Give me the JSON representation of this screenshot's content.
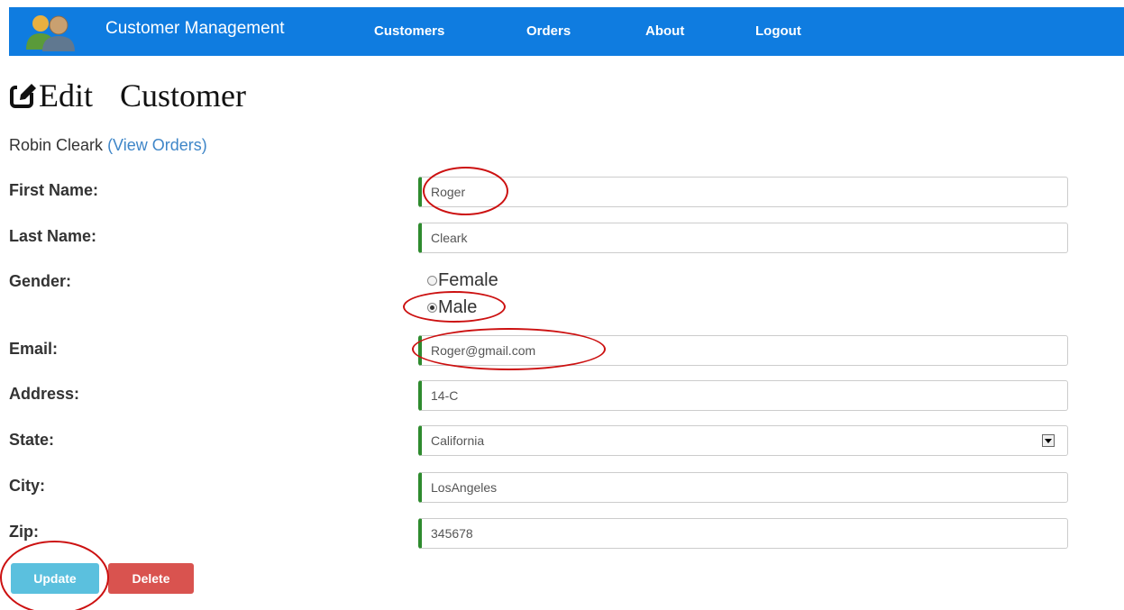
{
  "navbar": {
    "brand": "Customer Management",
    "links": [
      "Customers",
      "Orders",
      "About",
      "Logout"
    ],
    "logo_icon": "users-icon",
    "color": "#0f7ce0"
  },
  "heading": {
    "icon": "edit-icon",
    "word1": "Edit",
    "word2": "Customer"
  },
  "subtitle": {
    "name": "Robin Cleark",
    "link": "(View Orders)"
  },
  "form": {
    "first_name": {
      "label": "First Name:",
      "value": "Roger"
    },
    "last_name": {
      "label": "Last Name:",
      "value": "Cleark"
    },
    "gender": {
      "label": "Gender:",
      "options": [
        "Female",
        "Male"
      ],
      "selected": "Male"
    },
    "email": {
      "label": "Email:",
      "value": "Roger@gmail.com"
    },
    "address": {
      "label": "Address:",
      "value": "14-C"
    },
    "state": {
      "label": "State:",
      "value": "California"
    },
    "city": {
      "label": "City:",
      "value": "LosAngeles"
    },
    "zip": {
      "label": "Zip:",
      "value": "345678"
    }
  },
  "buttons": {
    "update": "Update",
    "delete": "Delete"
  },
  "colors": {
    "valid_border": "#2e8b2e",
    "update": "#5bc0de",
    "delete": "#d9534f",
    "annotation": "#cc1111"
  }
}
